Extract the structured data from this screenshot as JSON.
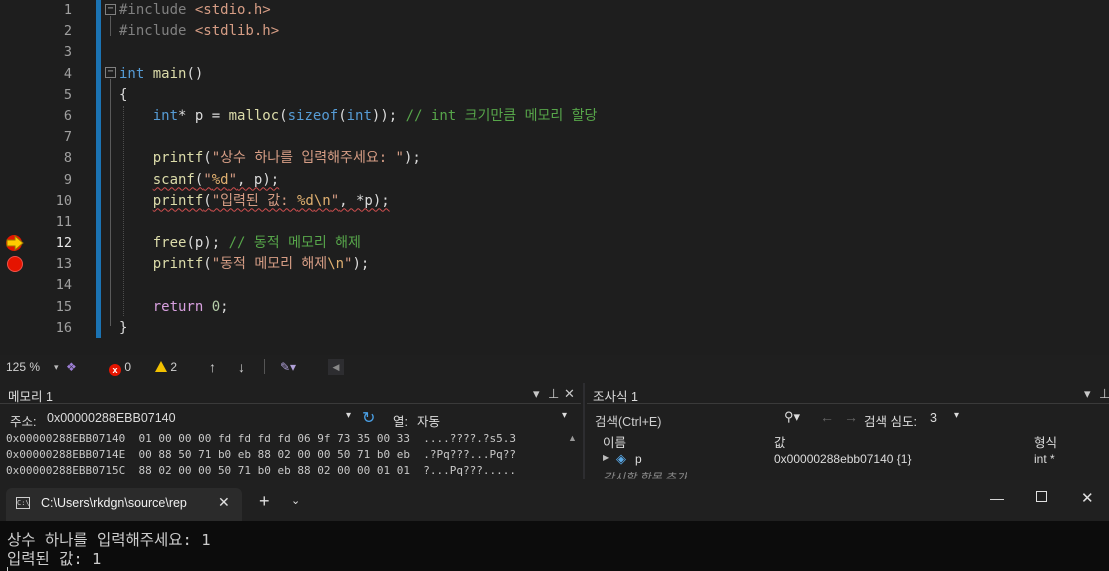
{
  "editor": {
    "line_numbers": [
      "1",
      "2",
      "3",
      "4",
      "5",
      "6",
      "7",
      "8",
      "9",
      "10",
      "11",
      "12",
      "13",
      "14",
      "15",
      "16"
    ],
    "code": {
      "l1": {
        "pp": "#include ",
        "hdr": "<stdio.h>"
      },
      "l2": {
        "pp": "#include ",
        "hdr": "<stdlib.h>"
      },
      "l4": {
        "kw": "int",
        "fn": "main",
        "rest": "()"
      },
      "l5": {
        "brace": "{"
      },
      "l6": {
        "kw1": "int",
        "a": "* p = ",
        "fn": "malloc",
        "b": "(",
        "kw2": "sizeof",
        "c": "(",
        "kw3": "int",
        "d": ")); ",
        "cm": "// int 크기만큼 메모리 할당"
      },
      "l8": {
        "fn": "printf",
        "a": "(",
        "str": "\"상수 하나를 입력해주세요: \"",
        "b": ");"
      },
      "l9": {
        "fn": "scanf",
        "a": "(",
        "str1": "\"",
        "esc": "%d",
        "str2": "\"",
        "b": ", p);"
      },
      "l10": {
        "fn": "printf",
        "a": "(",
        "str1": "\"입력된 값: ",
        "esc1": "%d",
        "esc2": "\\n",
        "str2": "\"",
        "b": ", *p);"
      },
      "l12": {
        "fn": "free",
        "a": "(p); ",
        "cm": "// 동적 메모리 해제"
      },
      "l13": {
        "fn": "printf",
        "a": "(",
        "str1": "\"동적 메모리 해제",
        "esc": "\\n",
        "str2": "\"",
        "b": ");"
      },
      "l15": {
        "ctl": "return",
        "a": " ",
        "num": "0",
        "b": ";"
      },
      "l16": {
        "brace": "}"
      }
    }
  },
  "status": {
    "zoom": "125 %",
    "errors": "0",
    "warnings": "2",
    "error_icon": "x",
    "up_arrow": "↑",
    "down_arrow": "↓"
  },
  "memory_pane": {
    "title": "메모리 1",
    "address_label": "주소:",
    "address_value": "0x00000288EBB07140",
    "columns_label": "열:",
    "columns_value": "자동",
    "rows": [
      {
        "addr": "0x00000288EBB07140",
        "bytes": "01 00 00 00 fd fd fd fd 06 9f 73 35 00 33",
        "ascii": "....????.?s5.3"
      },
      {
        "addr": "0x00000288EBB0714E",
        "bytes": "00 88 50 71 b0 eb 88 02 00 00 50 71 b0 eb",
        "ascii": ".?Pq???...Pq??"
      },
      {
        "addr": "0x00000288EBB0715C",
        "bytes": "88 02 00 00 50 71 b0 eb 88 02 00 00 01 01",
        "ascii": "?...Pq???....."
      }
    ]
  },
  "watch_pane": {
    "title": "조사식 1",
    "search_label": "검색(Ctrl+E)",
    "depth_label": "검색 심도:",
    "depth_value": "3",
    "col_name": "이름",
    "col_value": "값",
    "col_type": "형식",
    "row_name": "p",
    "row_value": "0x00000288ebb07140 {1}",
    "row_type": "int *",
    "add_hint": "감시할 항목 추가"
  },
  "terminal": {
    "tab_title": "C:\\Users\\rkdgn\\source\\rep",
    "lines": [
      "상수 하나를 입력해주세요: 1",
      "입력된 값: 1"
    ]
  }
}
